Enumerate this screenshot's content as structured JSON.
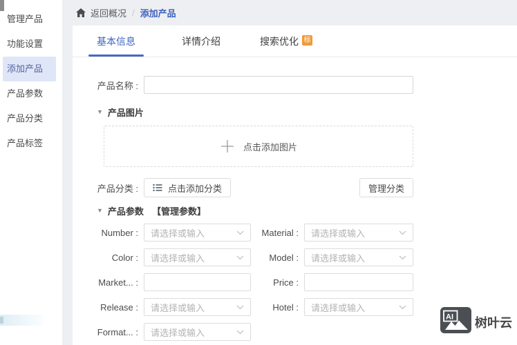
{
  "colors": {
    "accent": "#3f63c0",
    "badge_orange": "#f19a38",
    "background": "#edeff2",
    "sidebar_active_bg": "#dfe6f8"
  },
  "sidebar": {
    "items": [
      {
        "label": "管理产品",
        "active": false
      },
      {
        "label": "功能设置",
        "active": false
      },
      {
        "label": "添加产品",
        "active": true
      },
      {
        "label": "产品参数",
        "active": false
      },
      {
        "label": "产品分类",
        "active": false
      },
      {
        "label": "产品标签",
        "active": false
      }
    ]
  },
  "breadcrumb": {
    "back": "返回概况",
    "separator": "/",
    "current": "添加产品"
  },
  "tabs": [
    {
      "label": "基本信息",
      "active": true
    },
    {
      "label": "详情介绍",
      "active": false
    },
    {
      "label": "搜索优化",
      "active": false,
      "badge": "标"
    }
  ],
  "form": {
    "name_label": "产品名称 :",
    "name_value": "",
    "image_section": {
      "title": "产品图片",
      "upload_hint": "点击添加图片"
    },
    "category": {
      "label": "产品分类 :",
      "add_button": "点击添加分类",
      "manage_button": "管理分类"
    },
    "params_section": {
      "title": "产品参数",
      "manage": "【管理参数】"
    },
    "select_placeholder": "请选择或输入",
    "fields": [
      {
        "label": "Number :",
        "type": "select"
      },
      {
        "label": "Material :",
        "type": "select"
      },
      {
        "label": "Color :",
        "type": "select"
      },
      {
        "label": "Model :",
        "type": "select"
      },
      {
        "label": "Market... :",
        "type": "input"
      },
      {
        "label": "Price :",
        "type": "input"
      },
      {
        "label": "Release :",
        "type": "select"
      },
      {
        "label": "Hotel :",
        "type": "select"
      },
      {
        "label": "Format... :",
        "type": "select"
      }
    ]
  },
  "watermark": {
    "ai": "AI",
    "brand": "树叶云"
  }
}
